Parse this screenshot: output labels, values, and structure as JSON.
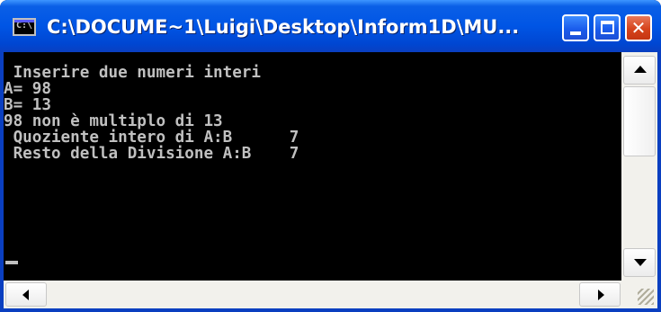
{
  "window": {
    "title": "C:\\DOCUME~1\\Luigi\\Desktop\\Inform1D\\MU...",
    "icon_label": "C:\\",
    "icon": "console-icon",
    "colors": {
      "titlebar": "#0055e5",
      "console_bg": "#000000",
      "console_text": "#c0c0c0",
      "close_button": "#d6431c"
    }
  },
  "console": {
    "lines": [
      " Inserire due numeri interi",
      "A= 98",
      "B= 13",
      "98 non è multiplo di 13",
      " Quoziente intero di A:B      7",
      " Resto della Divisione A:B    7"
    ]
  }
}
